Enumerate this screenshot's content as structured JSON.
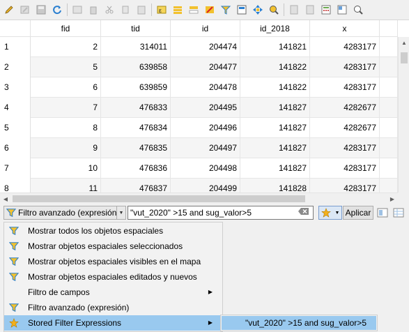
{
  "toolbar": {
    "icons": [
      "edit-pencil-icon",
      "toggle-multi-edit-icon",
      "save-icon",
      "reload-icon",
      "add-feature-icon",
      "delete-feature-icon",
      "cut-icon",
      "copy-icon",
      "paste-icon",
      "expression-select-icon",
      "select-all-icon",
      "invert-selection-icon",
      "deselect-icon",
      "filter-select-icon",
      "move-selection-top-icon",
      "pan-to-selection-icon",
      "zoom-to-selection-icon",
      "new-field-icon",
      "delete-field-icon",
      "field-calculator-icon",
      "conditional-format-icon",
      "dock-table-icon",
      "actions-icon"
    ]
  },
  "table": {
    "columns": [
      "",
      "fid",
      "tid",
      "id",
      "id_2018",
      "x"
    ],
    "rows": [
      {
        "n": "1",
        "fid": "2",
        "tid": "314011",
        "id": "204474",
        "id_2018": "141821",
        "x": "4283177"
      },
      {
        "n": "2",
        "fid": "5",
        "tid": "639858",
        "id": "204477",
        "id_2018": "141822",
        "x": "4283177"
      },
      {
        "n": "3",
        "fid": "6",
        "tid": "639859",
        "id": "204478",
        "id_2018": "141822",
        "x": "4283177"
      },
      {
        "n": "4",
        "fid": "7",
        "tid": "476833",
        "id": "204495",
        "id_2018": "141827",
        "x": "4282677"
      },
      {
        "n": "5",
        "fid": "8",
        "tid": "476834",
        "id": "204496",
        "id_2018": "141827",
        "x": "4282677"
      },
      {
        "n": "6",
        "fid": "9",
        "tid": "476835",
        "id": "204497",
        "id_2018": "141827",
        "x": "4283177"
      },
      {
        "n": "7",
        "fid": "10",
        "tid": "476836",
        "id": "204498",
        "id_2018": "141827",
        "x": "4283177"
      },
      {
        "n": "8",
        "fid": "11",
        "tid": "476837",
        "id": "204499",
        "id_2018": "141828",
        "x": "4283177"
      }
    ]
  },
  "filterbar": {
    "mode_label": "Filtro avanzado (expresión)",
    "expression": "\"vut_2020\" >15 and sug_valor>5",
    "apply_label": "Aplicar"
  },
  "menu": {
    "items": [
      {
        "label": "Mostrar todos los objetos espaciales",
        "icon": "filter-icon",
        "submenu": false
      },
      {
        "label": "Mostrar objetos espaciales seleccionados",
        "icon": "filter-icon",
        "submenu": false
      },
      {
        "label": "Mostrar objetos espaciales visibles en el mapa",
        "icon": "filter-icon",
        "submenu": false
      },
      {
        "label": "Mostrar objetos espaciales editados y nuevos",
        "icon": "filter-icon",
        "submenu": false
      },
      {
        "label": "Filtro de campos",
        "icon": "",
        "submenu": true
      },
      {
        "label": "Filtro avanzado (expresión)",
        "icon": "filter-icon",
        "submenu": false
      },
      {
        "label": "Stored Filter Expressions",
        "icon": "star-icon",
        "submenu": true
      }
    ],
    "submenu_item": "\"vut_2020\" >15 and sug_valor>5"
  },
  "colors": {
    "highlight": "#99c9ef",
    "filter_funnel": "#2f7fc4",
    "star": "#f2b01e"
  }
}
